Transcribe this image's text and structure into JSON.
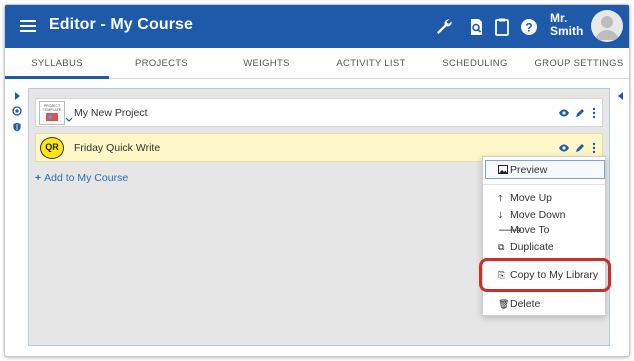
{
  "app": {
    "title": "Editor - My Course",
    "user_name_line1": "Mr.",
    "user_name_line2": "Smith",
    "accent_color": "#1e5aa9",
    "highlight_color": "#c9302c"
  },
  "header_icons": [
    "wrench-icon",
    "preview-doc-icon",
    "clipboard-icon",
    "help-icon",
    "user-avatar"
  ],
  "tabs": [
    {
      "label": "SYLLABUS",
      "active": true
    },
    {
      "label": "PROJECTS",
      "active": false
    },
    {
      "label": "WEIGHTS",
      "active": false
    },
    {
      "label": "ACTIVITY LIST",
      "active": false
    },
    {
      "label": "SCHEDULING",
      "active": false
    },
    {
      "label": "GROUP SETTINGS",
      "active": false
    }
  ],
  "items": [
    {
      "label": "My New Project",
      "thumb_text": "PROJECT TEMPLATE",
      "highlighted": false
    },
    {
      "label": "Friday Quick Write",
      "badge": "QR",
      "highlighted": true
    }
  ],
  "add_link": "Add to My Course",
  "context_menu": {
    "preview": "Preview",
    "move_up": "Move Up",
    "move_down": "Move Down",
    "move_to": "Move To",
    "duplicate": "Duplicate",
    "copy_to_library": "Copy to My Library",
    "delete": "Delete"
  }
}
